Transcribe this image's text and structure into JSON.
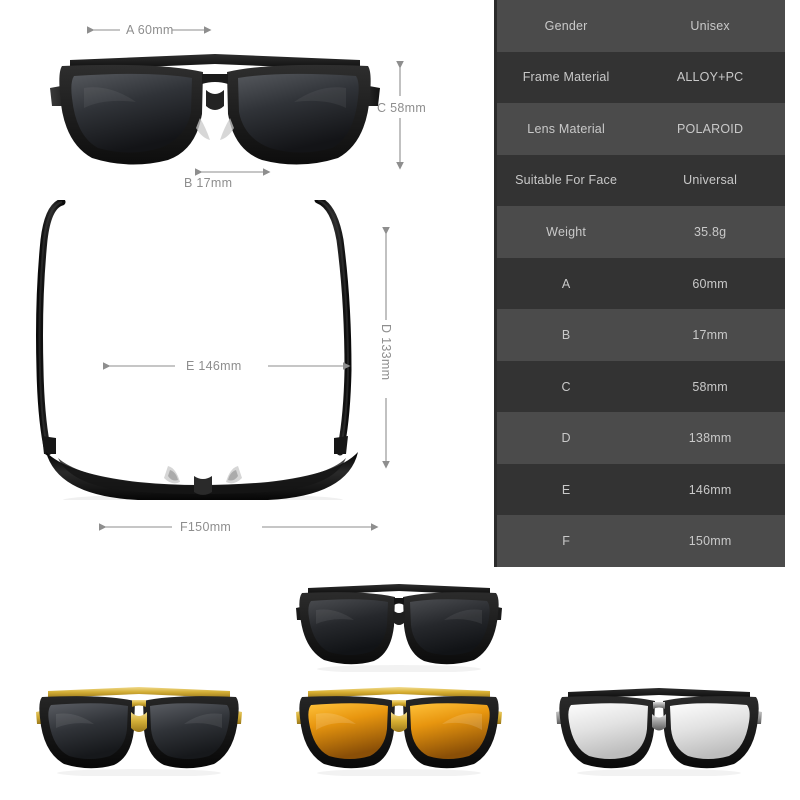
{
  "spec_table": {
    "rows": [
      {
        "key": "Gender",
        "value": "Unisex"
      },
      {
        "key": "Frame Material",
        "value": "ALLOY+PC"
      },
      {
        "key": "Lens Material",
        "value": "POLAROID"
      },
      {
        "key": "Suitable For Face",
        "value": "Universal"
      },
      {
        "key": "Weight",
        "value": "35.8g"
      },
      {
        "key": "A",
        "value": "60mm"
      },
      {
        "key": "B",
        "value": "17mm"
      },
      {
        "key": "C",
        "value": "58mm"
      },
      {
        "key": "D",
        "value": "138mm"
      },
      {
        "key": "E",
        "value": "146mm"
      },
      {
        "key": "F",
        "value": "150mm"
      }
    ],
    "colors": {
      "row_light": "#4b4b4b",
      "row_dark": "#333333",
      "text": "#c9c9c9",
      "border": "#2b2b2b"
    }
  },
  "dimensions": {
    "a": "A 60mm",
    "b": "B 17mm",
    "c": "C 58mm",
    "d": "D 133mm",
    "e": "E 146mm",
    "f": "F150mm",
    "line_color": "#8e8e8e"
  },
  "products": {
    "front_view": {
      "name": "Black frame front view with dimension callouts A, B, C"
    },
    "top_view": {
      "name": "Folded top-down view with dimension callouts D, E, F"
    },
    "variants": [
      {
        "name": "Black frame / black lens",
        "frame": "#1d1d1d",
        "bridge": "#262626",
        "lens_top": "#4a4c50",
        "lens_bottom": "#1b1d20"
      },
      {
        "name": "Gold frame / grey lens",
        "frame": "#161616",
        "bridge": "#d4af37",
        "lens_top": "#5a5d63",
        "lens_bottom": "#26282c"
      },
      {
        "name": "Gold frame / amber lens",
        "frame": "#171717",
        "bridge": "#d9b032",
        "lens_top": "#f0a81c",
        "lens_bottom": "#9a5a0b"
      },
      {
        "name": "Black frame / silver lens",
        "frame": "#1c1c1c",
        "bridge": "#9a9a9a",
        "lens_top": "#f2f2f2",
        "lens_bottom": "#c9c9c9"
      }
    ]
  }
}
